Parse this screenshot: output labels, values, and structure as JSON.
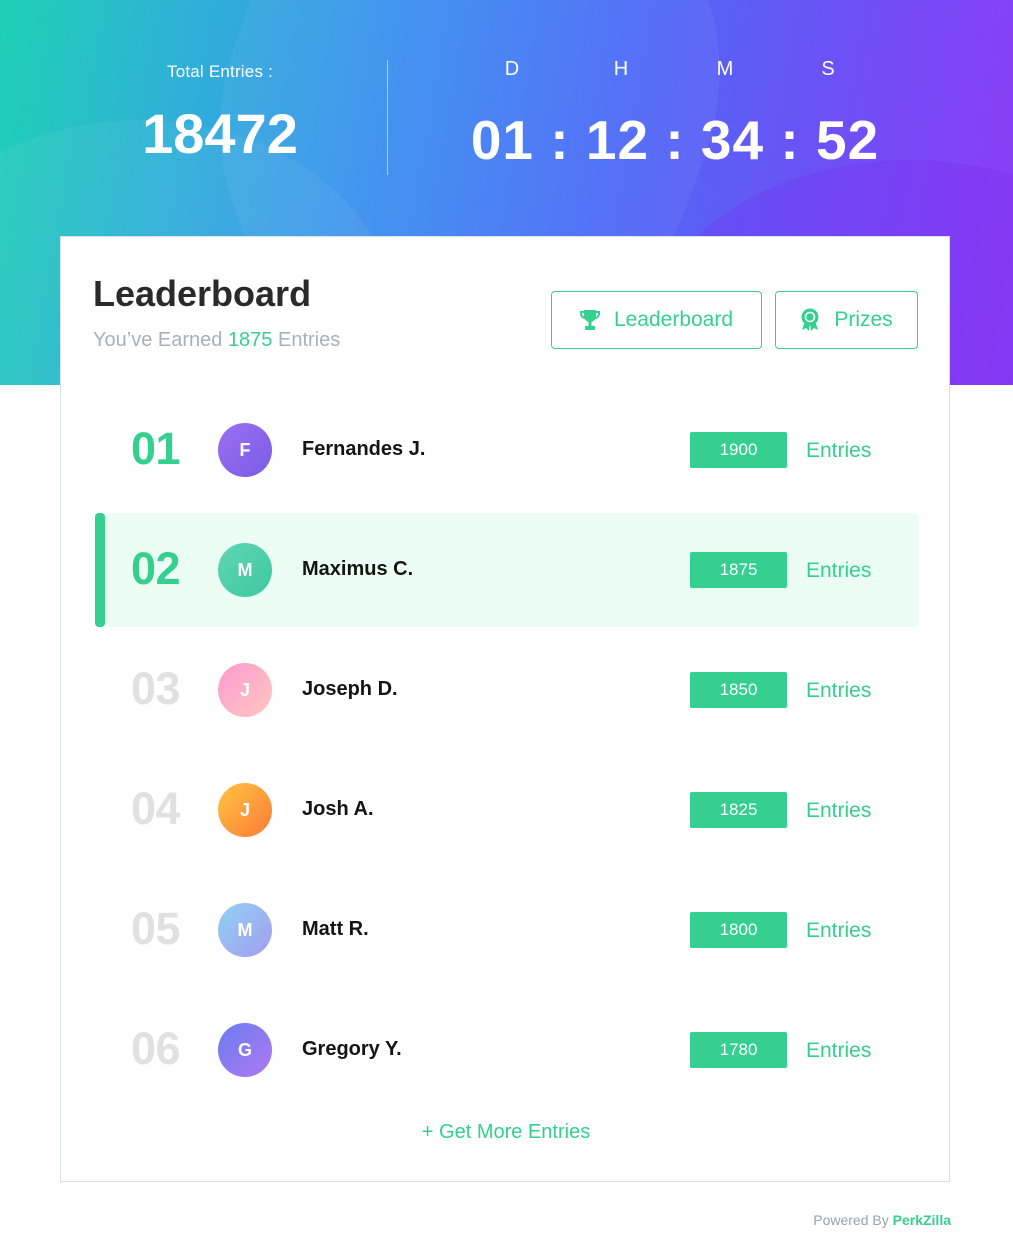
{
  "header": {
    "total_label": "Total Entries :",
    "total_value": "18472",
    "countdown": {
      "units": [
        "D",
        "H",
        "M",
        "S"
      ],
      "display": "01 : 12 : 34 : 52"
    }
  },
  "leaderboard": {
    "title": "Leaderboard",
    "earned_prefix": "You’ve Earned",
    "earned_value": "1875",
    "earned_suffix": "Entries",
    "tabs": {
      "leaderboard": "Leaderboard",
      "prizes": "Prizes"
    },
    "entries_label": "Entries",
    "rows": [
      {
        "rank": "01",
        "initial": "F",
        "name": "Fernandes J.",
        "entries": "1900"
      },
      {
        "rank": "02",
        "initial": "M",
        "name": "Maximus C.",
        "entries": "1875"
      },
      {
        "rank": "03",
        "initial": "J",
        "name": "Joseph D.",
        "entries": "1850"
      },
      {
        "rank": "04",
        "initial": "J",
        "name": "Josh A.",
        "entries": "1825"
      },
      {
        "rank": "05",
        "initial": "M",
        "name": "Matt R.",
        "entries": "1800"
      },
      {
        "rank": "06",
        "initial": "G",
        "name": "Gregory Y.",
        "entries": "1780"
      }
    ],
    "more_link": "+ Get More Entries"
  },
  "footer": {
    "powered_prefix": "Powered By",
    "brand": "PerkZilla"
  },
  "colors": {
    "accent": "#35cf8f",
    "active_row_bg": "#ebfdf5",
    "inactive_rank": "#e1e1e1"
  }
}
